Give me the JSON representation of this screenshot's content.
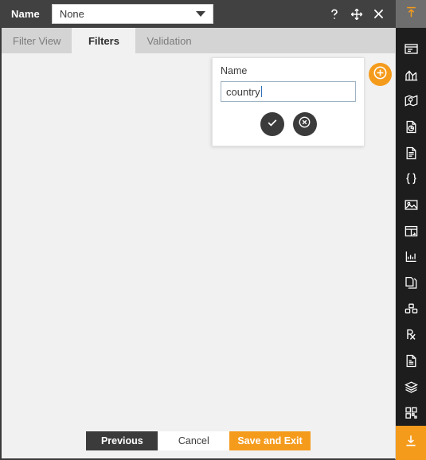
{
  "header": {
    "label": "Name",
    "select": {
      "value": "None",
      "caret_icon": "chevron-down-icon"
    },
    "actions": [
      {
        "name": "help-icon",
        "glyph": "?"
      },
      {
        "name": "move-icon",
        "glyph": "move"
      },
      {
        "name": "close-icon",
        "glyph": "close"
      }
    ]
  },
  "tabs": [
    {
      "label": "Filter View",
      "active": false
    },
    {
      "label": "Filters",
      "active": true
    },
    {
      "label": "Validation",
      "active": false
    }
  ],
  "popup": {
    "label": "Name",
    "input_value": "country",
    "input_placeholder": "",
    "confirm_icon": "check-icon",
    "cancel_icon": "circle-x-icon"
  },
  "add_button": {
    "icon": "plus-circle-icon",
    "color": "#f59b1c"
  },
  "footer": {
    "previous_label": "Previous",
    "cancel_label": "Cancel",
    "save_label": "Save and Exit"
  },
  "rail": {
    "top_icon": "upload-arrow-icon",
    "bottom_icon": "download-arrow-icon",
    "items": [
      {
        "icon": "panel-card-icon"
      },
      {
        "icon": "bar-chart-icon"
      },
      {
        "icon": "map-pin-icon"
      },
      {
        "icon": "document-chart-icon"
      },
      {
        "icon": "document-icon"
      },
      {
        "icon": "code-braces-icon"
      },
      {
        "icon": "image-icon"
      },
      {
        "icon": "table-icon"
      },
      {
        "icon": "line-chart-icon"
      },
      {
        "icon": "copy-document-icon"
      },
      {
        "icon": "cubes-icon"
      },
      {
        "icon": "prescription-rx-icon"
      },
      {
        "icon": "report-document-icon"
      },
      {
        "icon": "layers-stack-icon"
      },
      {
        "icon": "grid-dashboard-icon"
      }
    ]
  },
  "colors": {
    "accent_orange": "#f59b1c",
    "header_dark": "#414141",
    "rail_dark": "#1d1d1d",
    "content_bg": "#f1f1f1",
    "tab_inactive_bg": "#d4d4d4"
  }
}
